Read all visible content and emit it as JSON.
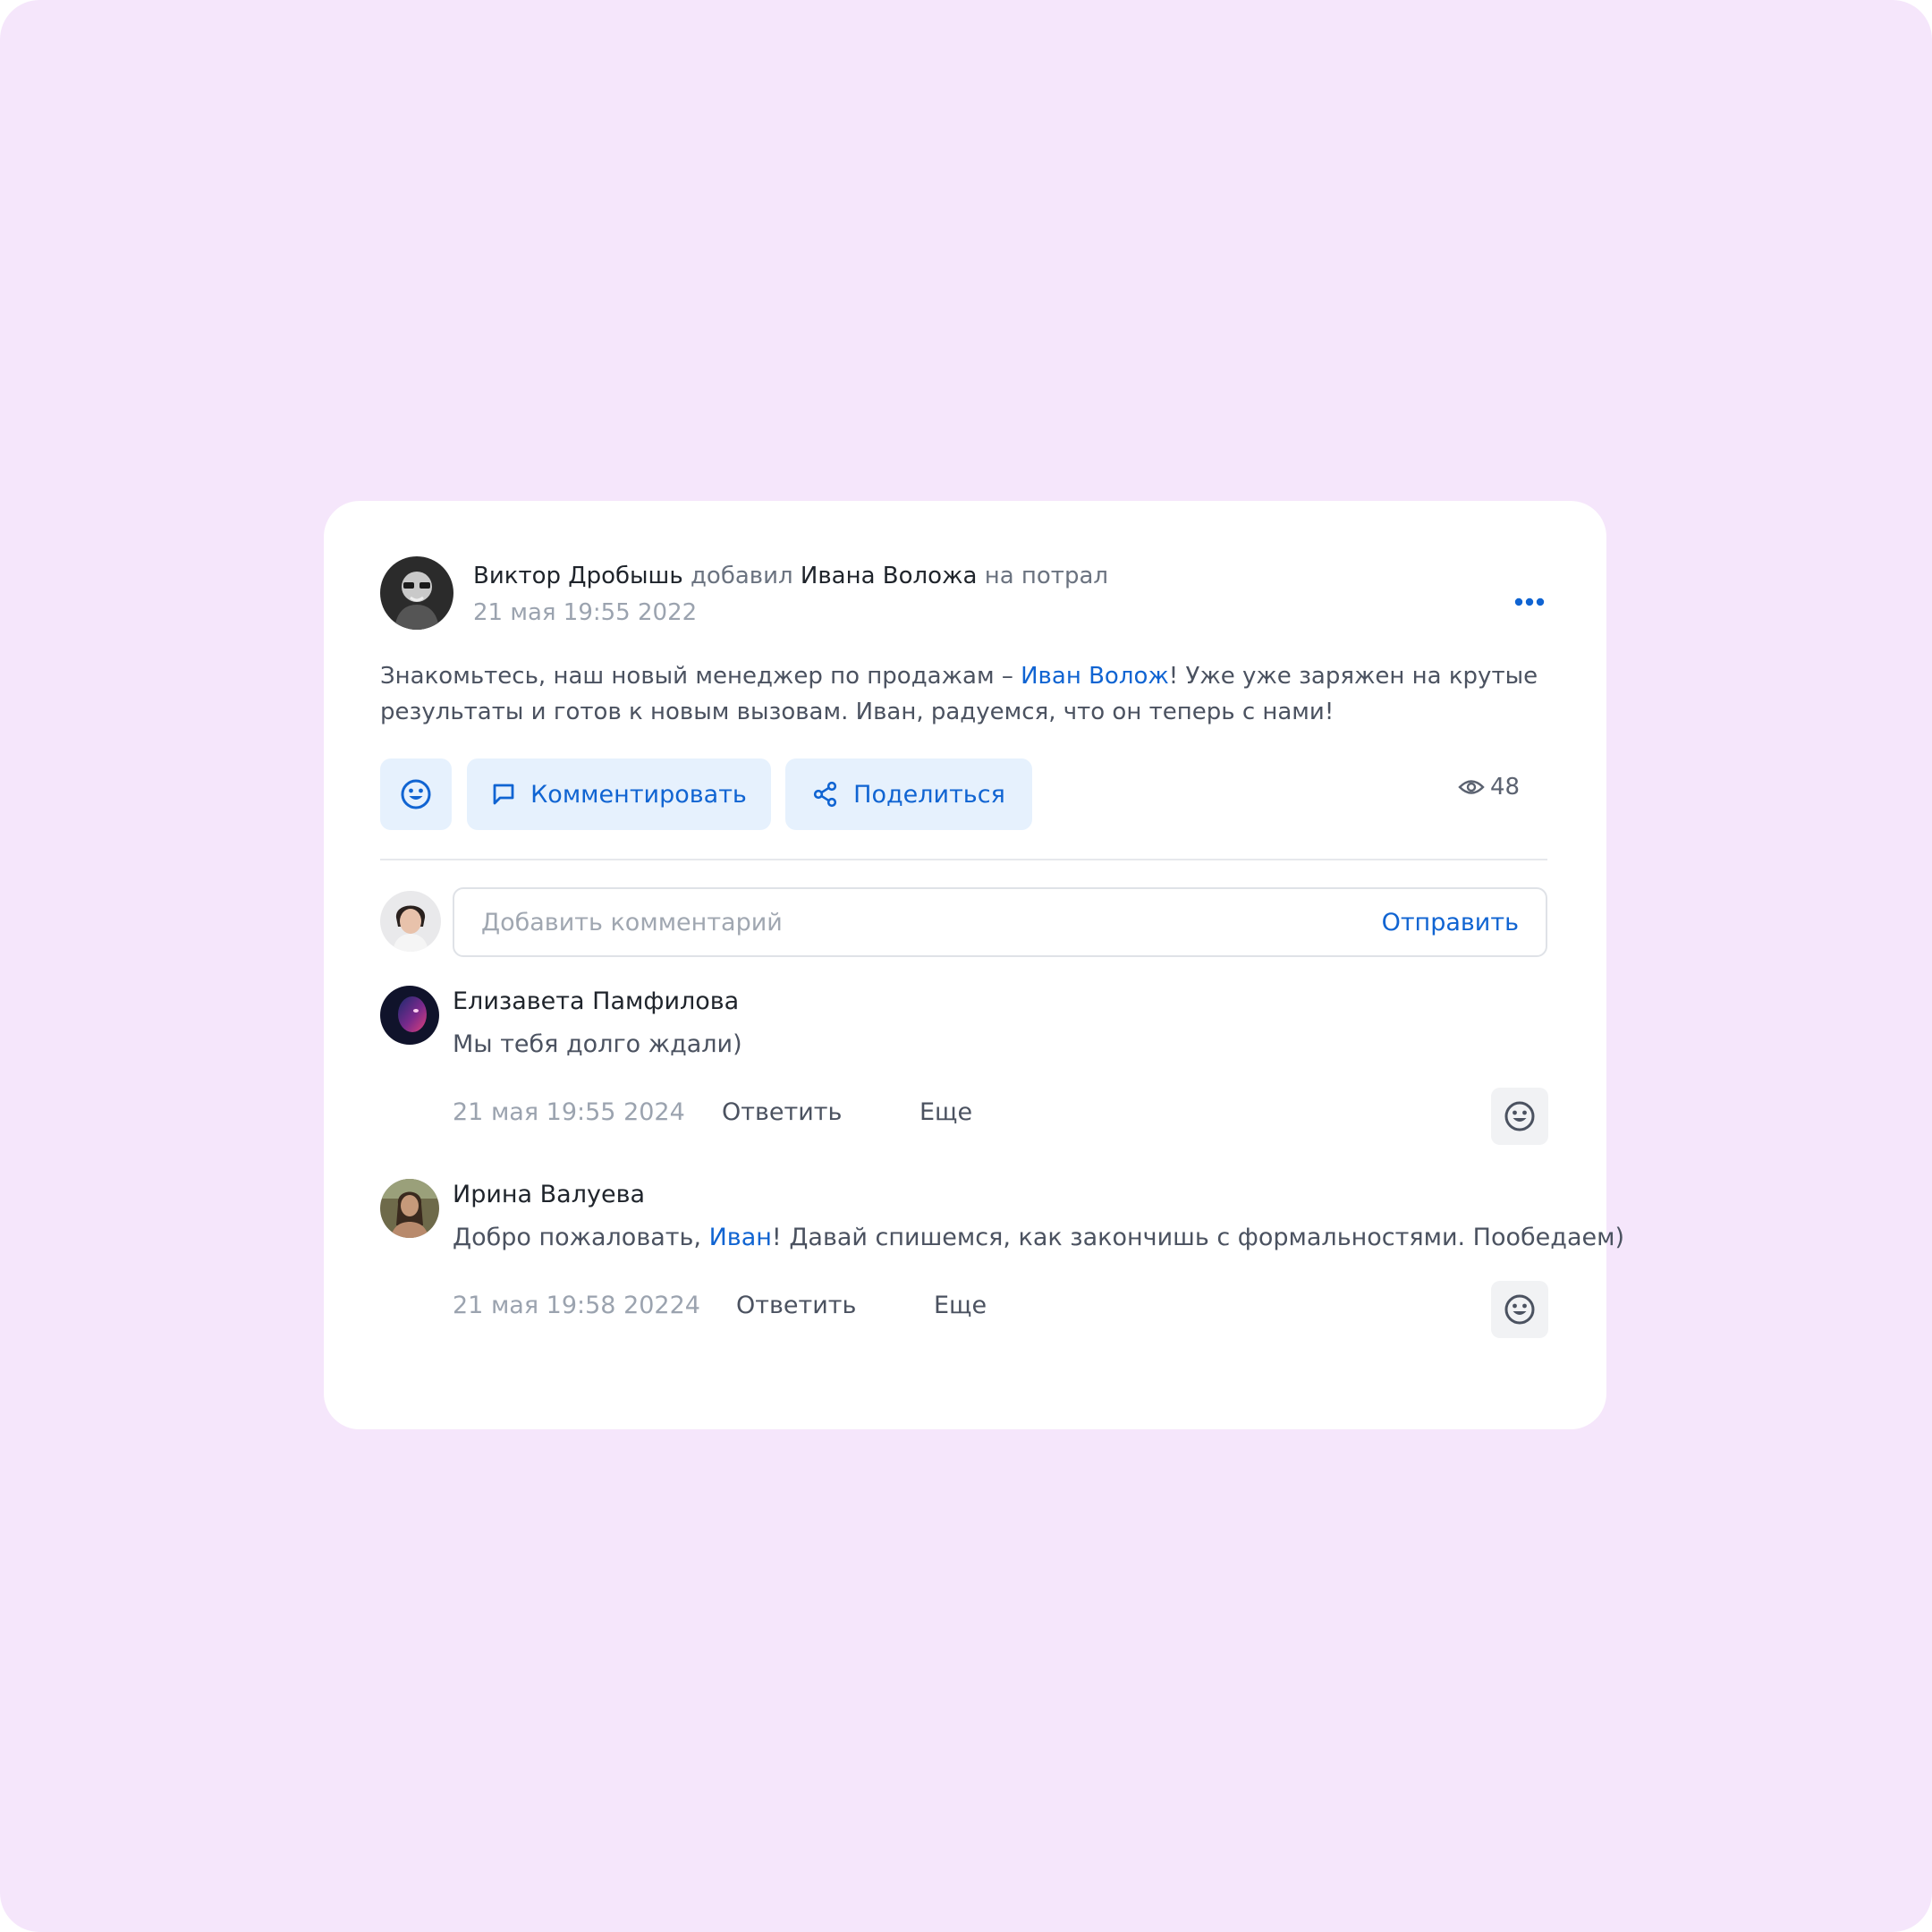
{
  "colors": {
    "background": "#f5e6fb",
    "accent": "#1064d2",
    "button_bg": "#e6f1fd"
  },
  "post": {
    "author": "Виктор Дробышь",
    "action": "добавил",
    "target": "Ивана Воложа",
    "suffix": "на потрал",
    "date": "21 мая 19:55 2022",
    "more_icon": "more-horizontal-icon",
    "text_before": "Знакомьтесь, наш новый менеджер по продажам – ",
    "mention": "Иван Волож",
    "text_after": "! Уже уже заряжен на крутые результаты и готов к новым вызовам. Иван, радуемся, что он теперь с нами!",
    "buttons": {
      "react_icon": "smile-icon",
      "comment_label": "Комментировать",
      "comment_icon": "message-square-icon",
      "share_label": "Поделиться",
      "share_icon": "share-icon"
    },
    "views": "48",
    "views_icon": "eye-icon"
  },
  "composer": {
    "placeholder": "Добавить комментарий",
    "send_label": "Отправить"
  },
  "comments": [
    {
      "author": "Елизавета Памфилова",
      "text": "Мы тебя долго ждали)",
      "date": "21 мая 19:55 2024",
      "reply_label": "Ответить",
      "more_label": "Еще"
    },
    {
      "author": "Ирина Валуева",
      "text_before": "Добро пожаловать, ",
      "mention": "Иван",
      "text_after": "! Давай спишемся, как закончишь с формальностями. Пообедаем)",
      "date": "21 мая 19:58 20224",
      "reply_label": "Ответить",
      "more_label": "Еще"
    }
  ]
}
